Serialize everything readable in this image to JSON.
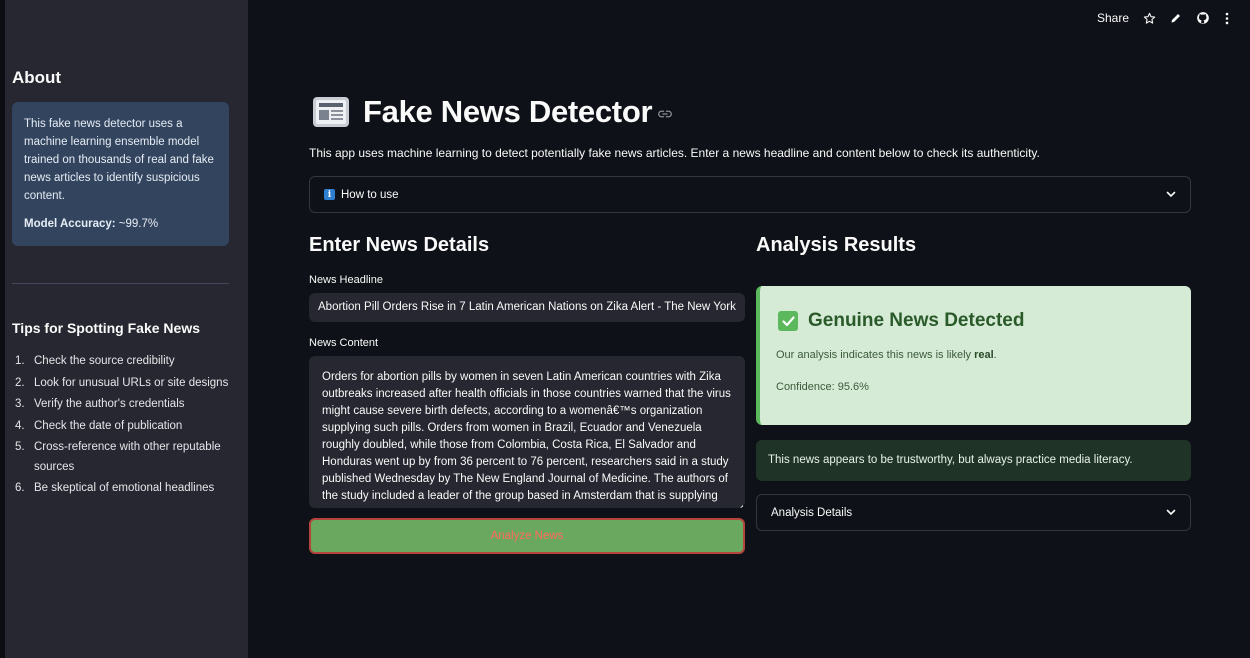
{
  "topbar": {
    "share_label": "Share",
    "icons": [
      "star-icon",
      "pencil-icon",
      "github-icon",
      "more-vertical-icon"
    ]
  },
  "sidebar": {
    "about_title": "About",
    "about_text": "This fake news detector uses a machine learning ensemble model trained on thousands of real and fake news articles to identify suspicious content.",
    "accuracy_label": "Model Accuracy:",
    "accuracy_value": " ~99.7%",
    "tips_title": "Tips for Spotting Fake News",
    "tips": [
      {
        "num": "1.",
        "text": "Check the source credibility"
      },
      {
        "num": "2.",
        "text": "Look for unusual URLs or site designs"
      },
      {
        "num": "3.",
        "text": "Verify the author's credentials"
      },
      {
        "num": "4.",
        "text": "Check the date of publication"
      },
      {
        "num": "5.",
        "text": "Cross-reference with other reputable sources"
      },
      {
        "num": "6.",
        "text": "Be skeptical of emotional headlines"
      }
    ]
  },
  "main": {
    "title": "Fake News Detector",
    "subtitle": "This app uses machine learning to detect potentially fake news articles. Enter a news headline and content below to check its authenticity.",
    "how_to_use_label": "How to use",
    "form": {
      "heading": "Enter News Details",
      "headline_label": "News Headline",
      "headline_value": "Abortion Pill Orders Rise in 7 Latin American Nations on Zika Alert - The New York Times",
      "content_label": "News Content",
      "content_value": "Orders for abortion pills by women in seven Latin American countries with Zika outbreaks increased after health officials in those countries warned that the virus might cause severe birth defects, according to a womenâ€™s organization supplying such pills. Orders from women in Brazil, Ecuador and Venezuela roughly doubled, while those from Colombia, Costa Rica, El Salvador and Honduras went up by from 36 percent to 76 percent, researchers said in a study published Wednesday by The New England Journal of Medicine. The authors of the study included a leader of the group based in Amsterdam that is supplying",
      "analyze_button": "Analyze News"
    },
    "results": {
      "heading": "Analysis Results",
      "verdict": "Genuine News Detected",
      "summary_prefix": "Our analysis indicates this news is likely ",
      "summary_bold": "real",
      "summary_suffix": ".",
      "confidence": "Confidence: 95.6%",
      "trust_message": "This news appears to be trustworthy, but always practice media literacy.",
      "details_label": "Analysis Details"
    }
  },
  "colors": {
    "background": "#0e1117",
    "sidebar": "#262730",
    "about_box": "#33455e",
    "result_card": "#d6ebd5",
    "success_accent": "#5cb85c",
    "analyze_button": "#6aa85f",
    "analyze_button_text": "#ff6b5f",
    "info_icon": "#2f7fd1"
  }
}
